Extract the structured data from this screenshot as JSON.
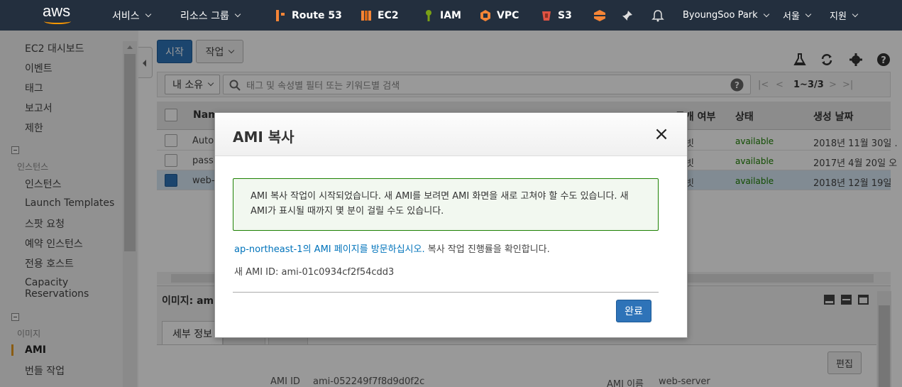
{
  "nav": {
    "logo": "aws",
    "services": "서비스",
    "resource_groups": "리소스 그룹",
    "shortcuts": [
      {
        "label": "Route 53",
        "icon": "route53-icon",
        "color": "#f58536"
      },
      {
        "label": "EC2",
        "icon": "ec2-icon",
        "color": "#f58536"
      },
      {
        "label": "IAM",
        "icon": "iam-icon",
        "color": "#7aa116"
      },
      {
        "label": "VPC",
        "icon": "vpc-icon",
        "color": "#f58536"
      },
      {
        "label": "S3",
        "icon": "s3-icon",
        "color": "#e05243"
      }
    ],
    "user": "ByoungSoo Park",
    "region": "서울",
    "support": "지원"
  },
  "sidebar": {
    "items_top": [
      "EC2 대시보드",
      "이벤트",
      "태그",
      "보고서",
      "제한"
    ],
    "section_instances": "인스턴스",
    "instances_items": [
      "인스턴스",
      "Launch Templates",
      "스팟 요청",
      "예약 인스턴스",
      "전용 호스트",
      "Capacity Reservations"
    ],
    "section_images": "이미지",
    "images_items": [
      "AMI",
      "번들 작업"
    ],
    "active": "AMI"
  },
  "toolbar": {
    "launch_label": "시작",
    "actions_label": "작업"
  },
  "filter": {
    "owner": "내 소유",
    "placeholder": "태그 및 속성별 필터 또는 키워드별 검색",
    "pager": "1~3/3"
  },
  "table": {
    "headers": [
      "Name",
      "공개 여부",
      "상태",
      "생성 날짜"
    ],
    "rows": [
      {
        "name": "Auto-",
        "visibility": "빗",
        "state": "available",
        "created": "2018년 11월 30일 .",
        "selected": false
      },
      {
        "name": "passb",
        "visibility": "빗",
        "state": "available",
        "created": "2017년 4월 20일 오",
        "selected": false
      },
      {
        "name": "web-s",
        "visibility": "빗",
        "state": "available",
        "created": "2018년 12월 19일",
        "selected": true
      }
    ]
  },
  "detail": {
    "title": "이미지: ami",
    "tab_details": "세부 정보",
    "edit_label": "편집",
    "ami_id_label": "AMI ID",
    "ami_id_value": "ami-052249f7f8d9d0f2c",
    "ami_name_label": "AMI 이름",
    "ami_name_value": "web-server"
  },
  "modal": {
    "title": "AMI 복사",
    "alert_text": "AMI 복사 작업이 시작되었습니다. 새 AMI를 보려면 AMI 화면을 새로 고쳐야 할 수도 있습니다. 새 AMI가 표시될 때까지 몇 분이 걸릴 수도 있습니다.",
    "link_text": "ap-northeast-1의 AMI 페이지를 방문하십시오.",
    "link_suffix": " 복사 작업 진행률을 확인합니다.",
    "new_ami_label": "새 AMI ID:",
    "new_ami_value": "ami-01c0934cf2f54cdd3",
    "done_label": "완료"
  }
}
